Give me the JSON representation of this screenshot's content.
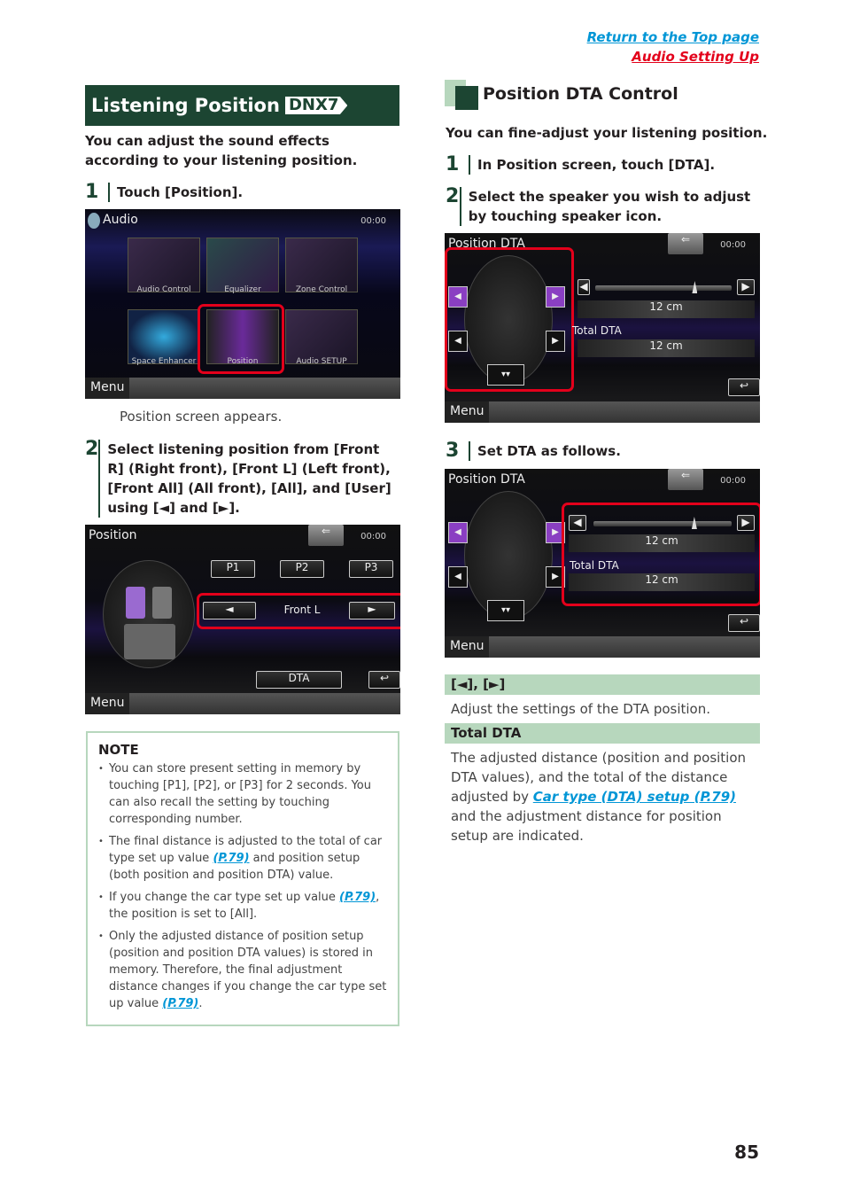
{
  "header": {
    "return_top": "Return to the Top page",
    "audio_setting_up": "Audio Setting Up"
  },
  "left": {
    "section_title": "Listening Position",
    "badge": "DNX7",
    "intro": "You can adjust the sound effects according to your listening position.",
    "step1": {
      "num": "1",
      "text": "Touch [Position]."
    },
    "audio_screen": {
      "title": "Audio",
      "clock": "00:00",
      "tiles": [
        "Audio Control",
        "Equalizer",
        "Zone Control",
        "Space Enhancer",
        "Position",
        "Audio SETUP"
      ],
      "menu": "Menu"
    },
    "step1_result": "Position screen appears.",
    "step2": {
      "num": "2",
      "text": "Select listening position from [Front R] (Right front), [Front L] (Left front), [Front All] (All front), [All], and [User] using [◄] and [►]."
    },
    "position_screen": {
      "title": "Position",
      "clock": "00:00",
      "presets": [
        "P1",
        "P2",
        "P3"
      ],
      "current": "Front L",
      "prev": "◄",
      "next": "►",
      "dta": "DTA",
      "menu": "Menu"
    },
    "note": {
      "title": "NOTE",
      "items": [
        {
          "text": "You can store present setting in memory by touching [P1], [P2], or [P3] for 2 seconds. You can also recall the setting by touching corresponding number."
        },
        {
          "pre": "The final distance is adjusted to the total of car type set up value ",
          "ref": "(P.79)",
          "post": " and position setup (both position and position DTA) value."
        },
        {
          "pre": "If you change the car type set up value ",
          "ref": "(P.79)",
          "post": ", the position is set to [All]."
        },
        {
          "pre": "Only the adjusted distance of position setup (position and position DTA values) is stored in memory. Therefore, the final adjustment distance changes if you change the car type set up value ",
          "ref": "(P.79)",
          "post": "."
        }
      ]
    }
  },
  "right": {
    "section_title": "Position DTA Control",
    "intro": "You can fine-adjust your listening position.",
    "step1": {
      "num": "1",
      "text": "In Position screen, touch [DTA]."
    },
    "step2": {
      "num": "2",
      "text": "Select the speaker you wish to adjust by touching speaker icon."
    },
    "step3": {
      "num": "3",
      "text": "Set DTA as follows."
    },
    "dta_screen": {
      "title": "Position DTA",
      "clock": "00:00",
      "value": "12 cm",
      "total_label": "Total DTA",
      "total_value": "12 cm",
      "slider_fraction": 0.73,
      "menu": "Menu"
    },
    "items": [
      {
        "header": "[◄], [►]",
        "body": "Adjust the settings of the DTA position."
      },
      {
        "header": "Total DTA",
        "pre": "The adjusted distance (position and position DTA values), and the total of the distance adjusted by ",
        "ref": "Car type (DTA) setup (P.79)",
        "post": " and the adjustment distance for position setup are indicated."
      }
    ]
  },
  "page_number": "85"
}
